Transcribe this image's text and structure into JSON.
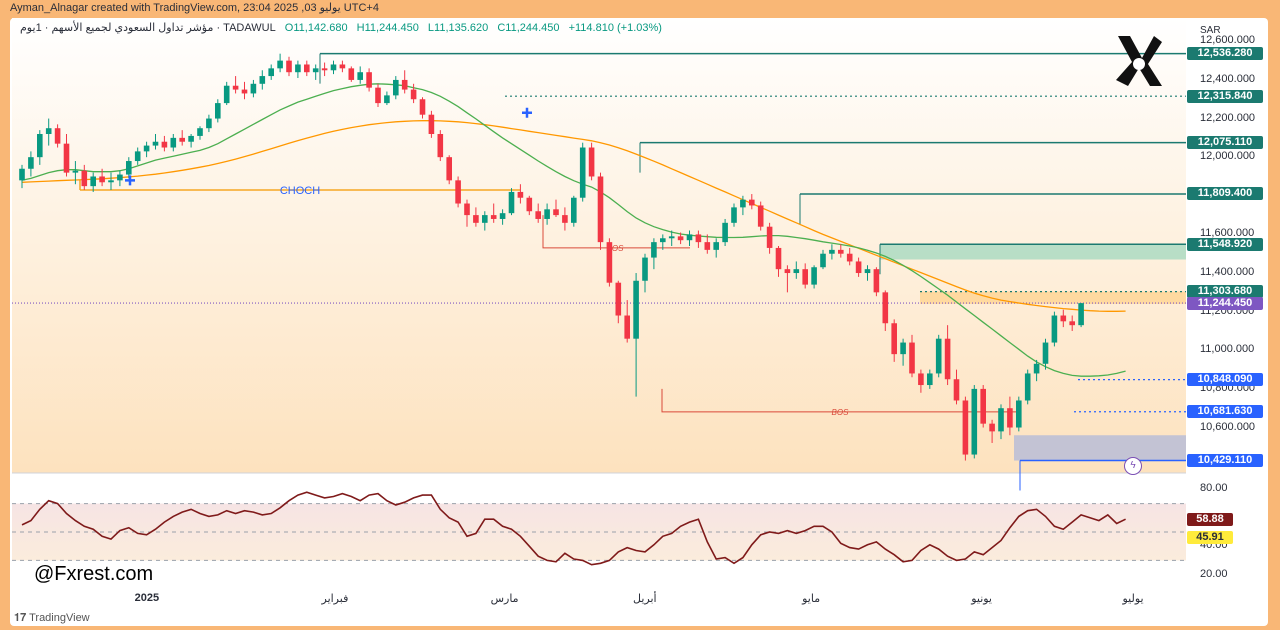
{
  "header": {
    "attribution": "Ayman_Alnagar created with TradingView.com, 23:04 2025 ,03 يوليو UTC+4"
  },
  "legend": {
    "symbol": "مؤشر تداول السعودي لجميع الأسهم · 1يوم · TADAWUL",
    "open": "O11,142.680",
    "high": "H11,244.450",
    "low": "L11,135.620",
    "close": "C11,244.450",
    "change": "+114.810 (+1.03%)"
  },
  "currency": "SAR",
  "watermark": "@Fxrest.com",
  "footer_logo": "TradingView",
  "colors": {
    "up": "#089981",
    "down": "#f23645",
    "ma_fast": "#4caf50",
    "ma_slow": "#ff9800",
    "rsi": "#7f1a1a",
    "level_line": "#1b7a70",
    "choch": "#f5a623",
    "bos": "#d94a3a"
  },
  "annotations": {
    "choch": "CHOCH",
    "bos_1": "BOS",
    "bos_2": "BOS"
  },
  "price_tags": [
    {
      "label": "12,536.280",
      "price": 12536.28,
      "color": "#1b7a70"
    },
    {
      "label": "12,315.840",
      "price": 12315.84,
      "color": "#1b7a70"
    },
    {
      "label": "12,075.110",
      "price": 12075.11,
      "color": "#1b7a70"
    },
    {
      "label": "11,809.400",
      "price": 11809.4,
      "color": "#1b7a70"
    },
    {
      "label": "11,548.920",
      "price": 11548.92,
      "color": "#1b7a70"
    },
    {
      "label": "11,303.680",
      "price": 11303.68,
      "color": "#1b7a70"
    },
    {
      "label": "11,244.450",
      "price": 11244.45,
      "color": "#7e57c2"
    },
    {
      "label": "10,848.090",
      "price": 10848.09,
      "color": "#2962ff"
    },
    {
      "label": "10,681.630",
      "price": 10681.63,
      "color": "#2962ff"
    },
    {
      "label": "10,429.110",
      "price": 10429.11,
      "color": "#2962ff"
    }
  ],
  "chart_data": {
    "type": "candlestick",
    "title": "",
    "yticks": [
      "12,600.000",
      "12,400.000",
      "12,200.000",
      "12,000.000",
      "11,800.000",
      "11,600.000",
      "11,400.000",
      "11,200.000",
      "11,000.000",
      "10,800.000",
      "10,600.000"
    ],
    "ytick_values": [
      12600,
      12400,
      12200,
      12000,
      11800,
      11600,
      11400,
      11200,
      11000,
      10800,
      10600
    ],
    "ylim": [
      10380,
      12700
    ],
    "months": [
      {
        "label": "2025",
        "bold": true,
        "index": 14
      },
      {
        "label": "فبراير",
        "bold": false,
        "index": 35
      },
      {
        "label": "مارس",
        "bold": false,
        "index": 54
      },
      {
        "label": "أبريل",
        "bold": false,
        "index": 70
      },
      {
        "label": "مايو",
        "bold": false,
        "index": 89
      },
      {
        "label": "يونيو",
        "bold": false,
        "index": 108
      },
      {
        "label": "يوليو",
        "bold": false,
        "index": 125
      }
    ],
    "ohlc": [
      [
        11880,
        11960,
        11840,
        11940
      ],
      [
        11940,
        12030,
        11900,
        12000
      ],
      [
        12000,
        12140,
        11960,
        12120
      ],
      [
        12120,
        12200,
        12060,
        12150
      ],
      [
        12150,
        12170,
        12050,
        12070
      ],
      [
        12070,
        12120,
        11900,
        11920
      ],
      [
        11920,
        11980,
        11860,
        11930
      ],
      [
        11930,
        11960,
        11830,
        11850
      ],
      [
        11850,
        11920,
        11820,
        11900
      ],
      [
        11900,
        11940,
        11850,
        11870
      ],
      [
        11870,
        11920,
        11830,
        11880
      ],
      [
        11880,
        11930,
        11850,
        11910
      ],
      [
        11910,
        12000,
        11890,
        11980
      ],
      [
        11980,
        12050,
        11960,
        12030
      ],
      [
        12030,
        12080,
        12000,
        12060
      ],
      [
        12060,
        12120,
        12040,
        12080
      ],
      [
        12080,
        12110,
        12030,
        12050
      ],
      [
        12050,
        12120,
        12030,
        12100
      ],
      [
        12100,
        12140,
        12060,
        12080
      ],
      [
        12080,
        12120,
        12050,
        12110
      ],
      [
        12110,
        12160,
        12090,
        12150
      ],
      [
        12150,
        12220,
        12130,
        12200
      ],
      [
        12200,
        12300,
        12180,
        12280
      ],
      [
        12280,
        12390,
        12270,
        12370
      ],
      [
        12370,
        12420,
        12330,
        12350
      ],
      [
        12350,
        12390,
        12300,
        12330
      ],
      [
        12330,
        12400,
        12310,
        12380
      ],
      [
        12380,
        12450,
        12350,
        12420
      ],
      [
        12420,
        12480,
        12400,
        12460
      ],
      [
        12460,
        12536,
        12440,
        12500
      ],
      [
        12500,
        12520,
        12420,
        12440
      ],
      [
        12440,
        12500,
        12410,
        12480
      ],
      [
        12480,
        12500,
        12420,
        12440
      ],
      [
        12440,
        12480,
        12400,
        12460
      ],
      [
        12460,
        12490,
        12420,
        12450
      ],
      [
        12450,
        12500,
        12430,
        12480
      ],
      [
        12480,
        12500,
        12440,
        12460
      ],
      [
        12460,
        12470,
        12390,
        12400
      ],
      [
        12400,
        12470,
        12380,
        12440
      ],
      [
        12440,
        12460,
        12340,
        12360
      ],
      [
        12360,
        12380,
        12260,
        12280
      ],
      [
        12280,
        12340,
        12270,
        12320
      ],
      [
        12320,
        12420,
        12300,
        12400
      ],
      [
        12400,
        12450,
        12330,
        12350
      ],
      [
        12350,
        12380,
        12280,
        12300
      ],
      [
        12300,
        12310,
        12200,
        12220
      ],
      [
        12220,
        12240,
        12100,
        12120
      ],
      [
        12120,
        12140,
        11980,
        12000
      ],
      [
        12000,
        12010,
        11860,
        11880
      ],
      [
        11880,
        11900,
        11740,
        11760
      ],
      [
        11760,
        11780,
        11640,
        11700
      ],
      [
        11700,
        11740,
        11640,
        11660
      ],
      [
        11660,
        11720,
        11620,
        11700
      ],
      [
        11700,
        11760,
        11660,
        11680
      ],
      [
        11680,
        11730,
        11650,
        11710
      ],
      [
        11710,
        11840,
        11700,
        11820
      ],
      [
        11820,
        11860,
        11760,
        11790
      ],
      [
        11790,
        11800,
        11700,
        11720
      ],
      [
        11720,
        11760,
        11660,
        11680
      ],
      [
        11680,
        11760,
        11650,
        11730
      ],
      [
        11730,
        11780,
        11690,
        11700
      ],
      [
        11700,
        11740,
        11620,
        11660
      ],
      [
        11660,
        11800,
        11640,
        11790
      ],
      [
        11790,
        12075,
        11770,
        12050
      ],
      [
        12050,
        12075,
        11880,
        11900
      ],
      [
        11900,
        11920,
        11520,
        11560
      ],
      [
        11560,
        11580,
        11330,
        11350
      ],
      [
        11350,
        11360,
        11140,
        11180
      ],
      [
        11180,
        11260,
        11040,
        11060
      ],
      [
        11060,
        11400,
        10760,
        11360
      ],
      [
        11360,
        11500,
        11300,
        11480
      ],
      [
        11480,
        11580,
        11420,
        11560
      ],
      [
        11560,
        11600,
        11520,
        11580
      ],
      [
        11580,
        11620,
        11540,
        11590
      ],
      [
        11590,
        11610,
        11550,
        11570
      ],
      [
        11570,
        11620,
        11540,
        11600
      ],
      [
        11600,
        11620,
        11530,
        11560
      ],
      [
        11560,
        11600,
        11500,
        11520
      ],
      [
        11520,
        11580,
        11480,
        11560
      ],
      [
        11560,
        11680,
        11540,
        11660
      ],
      [
        11660,
        11760,
        11640,
        11740
      ],
      [
        11740,
        11800,
        11700,
        11780
      ],
      [
        11780,
        11809,
        11730,
        11750
      ],
      [
        11750,
        11770,
        11620,
        11640
      ],
      [
        11640,
        11660,
        11500,
        11530
      ],
      [
        11530,
        11540,
        11380,
        11420
      ],
      [
        11420,
        11440,
        11300,
        11400
      ],
      [
        11400,
        11460,
        11370,
        11420
      ],
      [
        11420,
        11450,
        11320,
        11340
      ],
      [
        11340,
        11440,
        11320,
        11430
      ],
      [
        11430,
        11520,
        11420,
        11500
      ],
      [
        11500,
        11549,
        11470,
        11520
      ],
      [
        11520,
        11549,
        11480,
        11500
      ],
      [
        11500,
        11530,
        11440,
        11460
      ],
      [
        11460,
        11480,
        11380,
        11400
      ],
      [
        11400,
        11440,
        11360,
        11420
      ],
      [
        11420,
        11430,
        11280,
        11300
      ],
      [
        11300,
        11310,
        11100,
        11140
      ],
      [
        11140,
        11160,
        10940,
        10980
      ],
      [
        10980,
        11060,
        10920,
        11040
      ],
      [
        11040,
        11080,
        10860,
        10880
      ],
      [
        10880,
        10900,
        10780,
        10820
      ],
      [
        10820,
        10900,
        10800,
        10880
      ],
      [
        10880,
        11080,
        10860,
        11060
      ],
      [
        11060,
        11130,
        10820,
        10850
      ],
      [
        10850,
        10900,
        10720,
        10740
      ],
      [
        10740,
        10760,
        10429,
        10460
      ],
      [
        10460,
        10820,
        10440,
        10800
      ],
      [
        10800,
        10820,
        10600,
        10620
      ],
      [
        10620,
        10640,
        10520,
        10580
      ],
      [
        10580,
        10720,
        10540,
        10700
      ],
      [
        10700,
        10760,
        10560,
        10600
      ],
      [
        10600,
        10760,
        10580,
        10740
      ],
      [
        10740,
        10900,
        10720,
        10880
      ],
      [
        10880,
        10950,
        10840,
        10930
      ],
      [
        10930,
        11060,
        10900,
        11040
      ],
      [
        11040,
        11200,
        11020,
        11180
      ],
      [
        11180,
        11210,
        11120,
        11150
      ],
      [
        11150,
        11180,
        11100,
        11130
      ],
      [
        11130,
        11245,
        11120,
        11244
      ]
    ],
    "ma_fast": [
      11880,
      11890,
      11905,
      11920,
      11930,
      11935,
      11935,
      11930,
      11925,
      11925,
      11925,
      11930,
      11940,
      11955,
      11970,
      11985,
      11995,
      12005,
      12015,
      12025,
      12035,
      12050,
      12070,
      12095,
      12120,
      12145,
      12170,
      12195,
      12220,
      12245,
      12265,
      12285,
      12300,
      12315,
      12330,
      12345,
      12355,
      12365,
      12372,
      12378,
      12380,
      12378,
      12375,
      12370,
      12360,
      12350,
      12335,
      12315,
      12290,
      12262,
      12230,
      12198,
      12165,
      12132,
      12100,
      12070,
      12040,
      12010,
      11980,
      11952,
      11925,
      11900,
      11878,
      11860,
      11845,
      11820,
      11790,
      11755,
      11718,
      11685,
      11660,
      11640,
      11625,
      11612,
      11602,
      11596,
      11592,
      11588,
      11585,
      11584,
      11584,
      11585,
      11588,
      11592,
      11594,
      11594,
      11590,
      11584,
      11578,
      11570,
      11562,
      11555,
      11548,
      11540,
      11530,
      11518,
      11504,
      11486,
      11465,
      11440,
      11412,
      11382,
      11350,
      11318,
      11285,
      11250,
      11215,
      11180,
      11145,
      11110,
      11075,
      11040,
      11005,
      10970,
      10940,
      10915,
      10895,
      10880,
      10870,
      10866,
      10866,
      10868,
      10872,
      10880,
      10892
    ],
    "ma_slow": [
      11870,
      11872,
      11874,
      11876,
      11878,
      11880,
      11882,
      11884,
      11886,
      11888,
      11891,
      11894,
      11898,
      11902,
      11907,
      11912,
      11918,
      11925,
      11932,
      11940,
      11948,
      11957,
      11967,
      11978,
      11990,
      12003,
      12016,
      12030,
      12044,
      12058,
      12072,
      12086,
      12099,
      12111,
      12123,
      12134,
      12144,
      12153,
      12161,
      12168,
      12174,
      12179,
      12183,
      12186,
      12188,
      12189,
      12189,
      12188,
      12186,
      12183,
      12179,
      12174,
      12168,
      12162,
      12155,
      12148,
      12141,
      12134,
      12127,
      12120,
      12113,
      12106,
      12099,
      12092,
      12085,
      12075,
      12063,
      12049,
      12033,
      12016,
      11998,
      11979,
      11960,
      11940,
      11920,
      11900,
      11880,
      11860,
      11840,
      11820,
      11800,
      11780,
      11760,
      11740,
      11720,
      11700,
      11680,
      11660,
      11640,
      11620,
      11600,
      11582,
      11564,
      11546,
      11528,
      11510,
      11492,
      11474,
      11456,
      11438,
      11420,
      11402,
      11384,
      11366,
      11348,
      11330,
      11312,
      11296,
      11282,
      11270,
      11260,
      11252,
      11245,
      11238,
      11232,
      11226,
      11221,
      11216,
      11212,
      11208,
      11205,
      11203,
      11202,
      11202,
      11203
    ],
    "rsi": {
      "yticks": [
        "80.00",
        "40.00",
        "20.00"
      ],
      "ytick_values": [
        80,
        40,
        20
      ],
      "value_label": "58.88",
      "ma_label": "45.91",
      "ylim": [
        12,
        88
      ],
      "values": [
        55,
        58,
        66,
        72,
        70,
        63,
        58,
        54,
        52,
        47,
        45,
        51,
        53,
        49,
        48,
        52,
        57,
        61,
        64,
        66,
        63,
        61,
        62,
        65,
        63,
        65,
        64,
        62,
        63,
        67,
        72,
        76,
        78,
        76,
        74,
        75,
        77,
        75,
        72,
        76,
        77,
        72,
        69,
        71,
        74,
        76,
        76,
        66,
        60,
        57,
        47,
        49,
        59,
        59,
        54,
        52,
        47,
        40,
        33,
        30,
        29,
        35,
        31,
        30,
        27,
        28,
        30,
        36,
        39,
        37,
        36,
        41,
        47,
        49,
        54,
        57,
        59,
        43,
        31,
        32,
        28,
        32,
        41,
        48,
        50,
        49,
        51,
        49,
        51,
        54,
        54,
        50,
        42,
        39,
        38,
        41,
        43,
        38,
        34,
        29,
        30,
        37,
        41,
        38,
        33,
        30,
        31,
        36,
        34,
        39,
        44,
        53,
        61,
        65,
        66,
        61,
        54,
        52,
        57,
        62,
        60,
        58,
        62,
        56,
        59
      ]
    }
  }
}
